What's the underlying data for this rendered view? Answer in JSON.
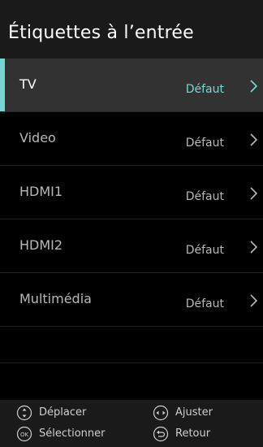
{
  "title": "Étiquettes à l’entrée",
  "accent_color": "#7ad6d0",
  "items": [
    {
      "label": "TV",
      "value": "Défaut",
      "selected": true,
      "icon": "chevron-right-icon"
    },
    {
      "label": "Video",
      "value": "Défaut",
      "selected": false,
      "icon": "chevron-right-icon"
    },
    {
      "label": "HDMI1",
      "value": "Défaut",
      "selected": false,
      "icon": "chevron-right-icon"
    },
    {
      "label": "HDMI2",
      "value": "Défaut",
      "selected": false,
      "icon": "chevron-right-icon"
    },
    {
      "label": "Multimédia",
      "value": "Défaut",
      "selected": false,
      "icon": "chevron-right-icon"
    }
  ],
  "hints": {
    "move": {
      "label": "Déplacer",
      "icon": "up-down-arrows-icon"
    },
    "adjust": {
      "label": "Ajuster",
      "icon": "left-right-arrows-icon"
    },
    "select": {
      "label": "Sélectionner",
      "icon": "ok-button-icon"
    },
    "back": {
      "label": "Retour",
      "icon": "back-icon"
    }
  }
}
